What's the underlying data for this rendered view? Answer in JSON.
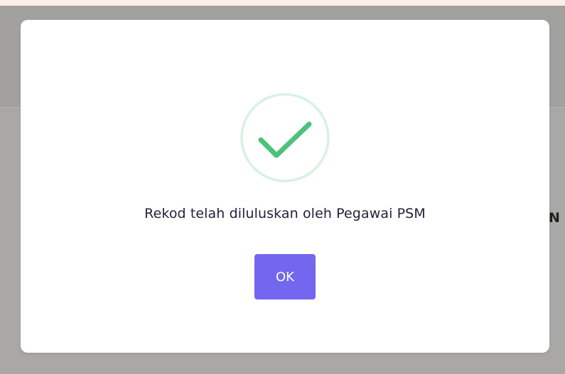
{
  "background": {
    "partial_text": "N"
  },
  "modal": {
    "icon": "check-circle-icon",
    "message": "Rekod telah diluluskan oleh Pegawai PSM",
    "ok_label": "OK",
    "colors": {
      "success_green": "#4cc27a",
      "ring": "#d7f2e1",
      "button": "#7367f0"
    }
  }
}
